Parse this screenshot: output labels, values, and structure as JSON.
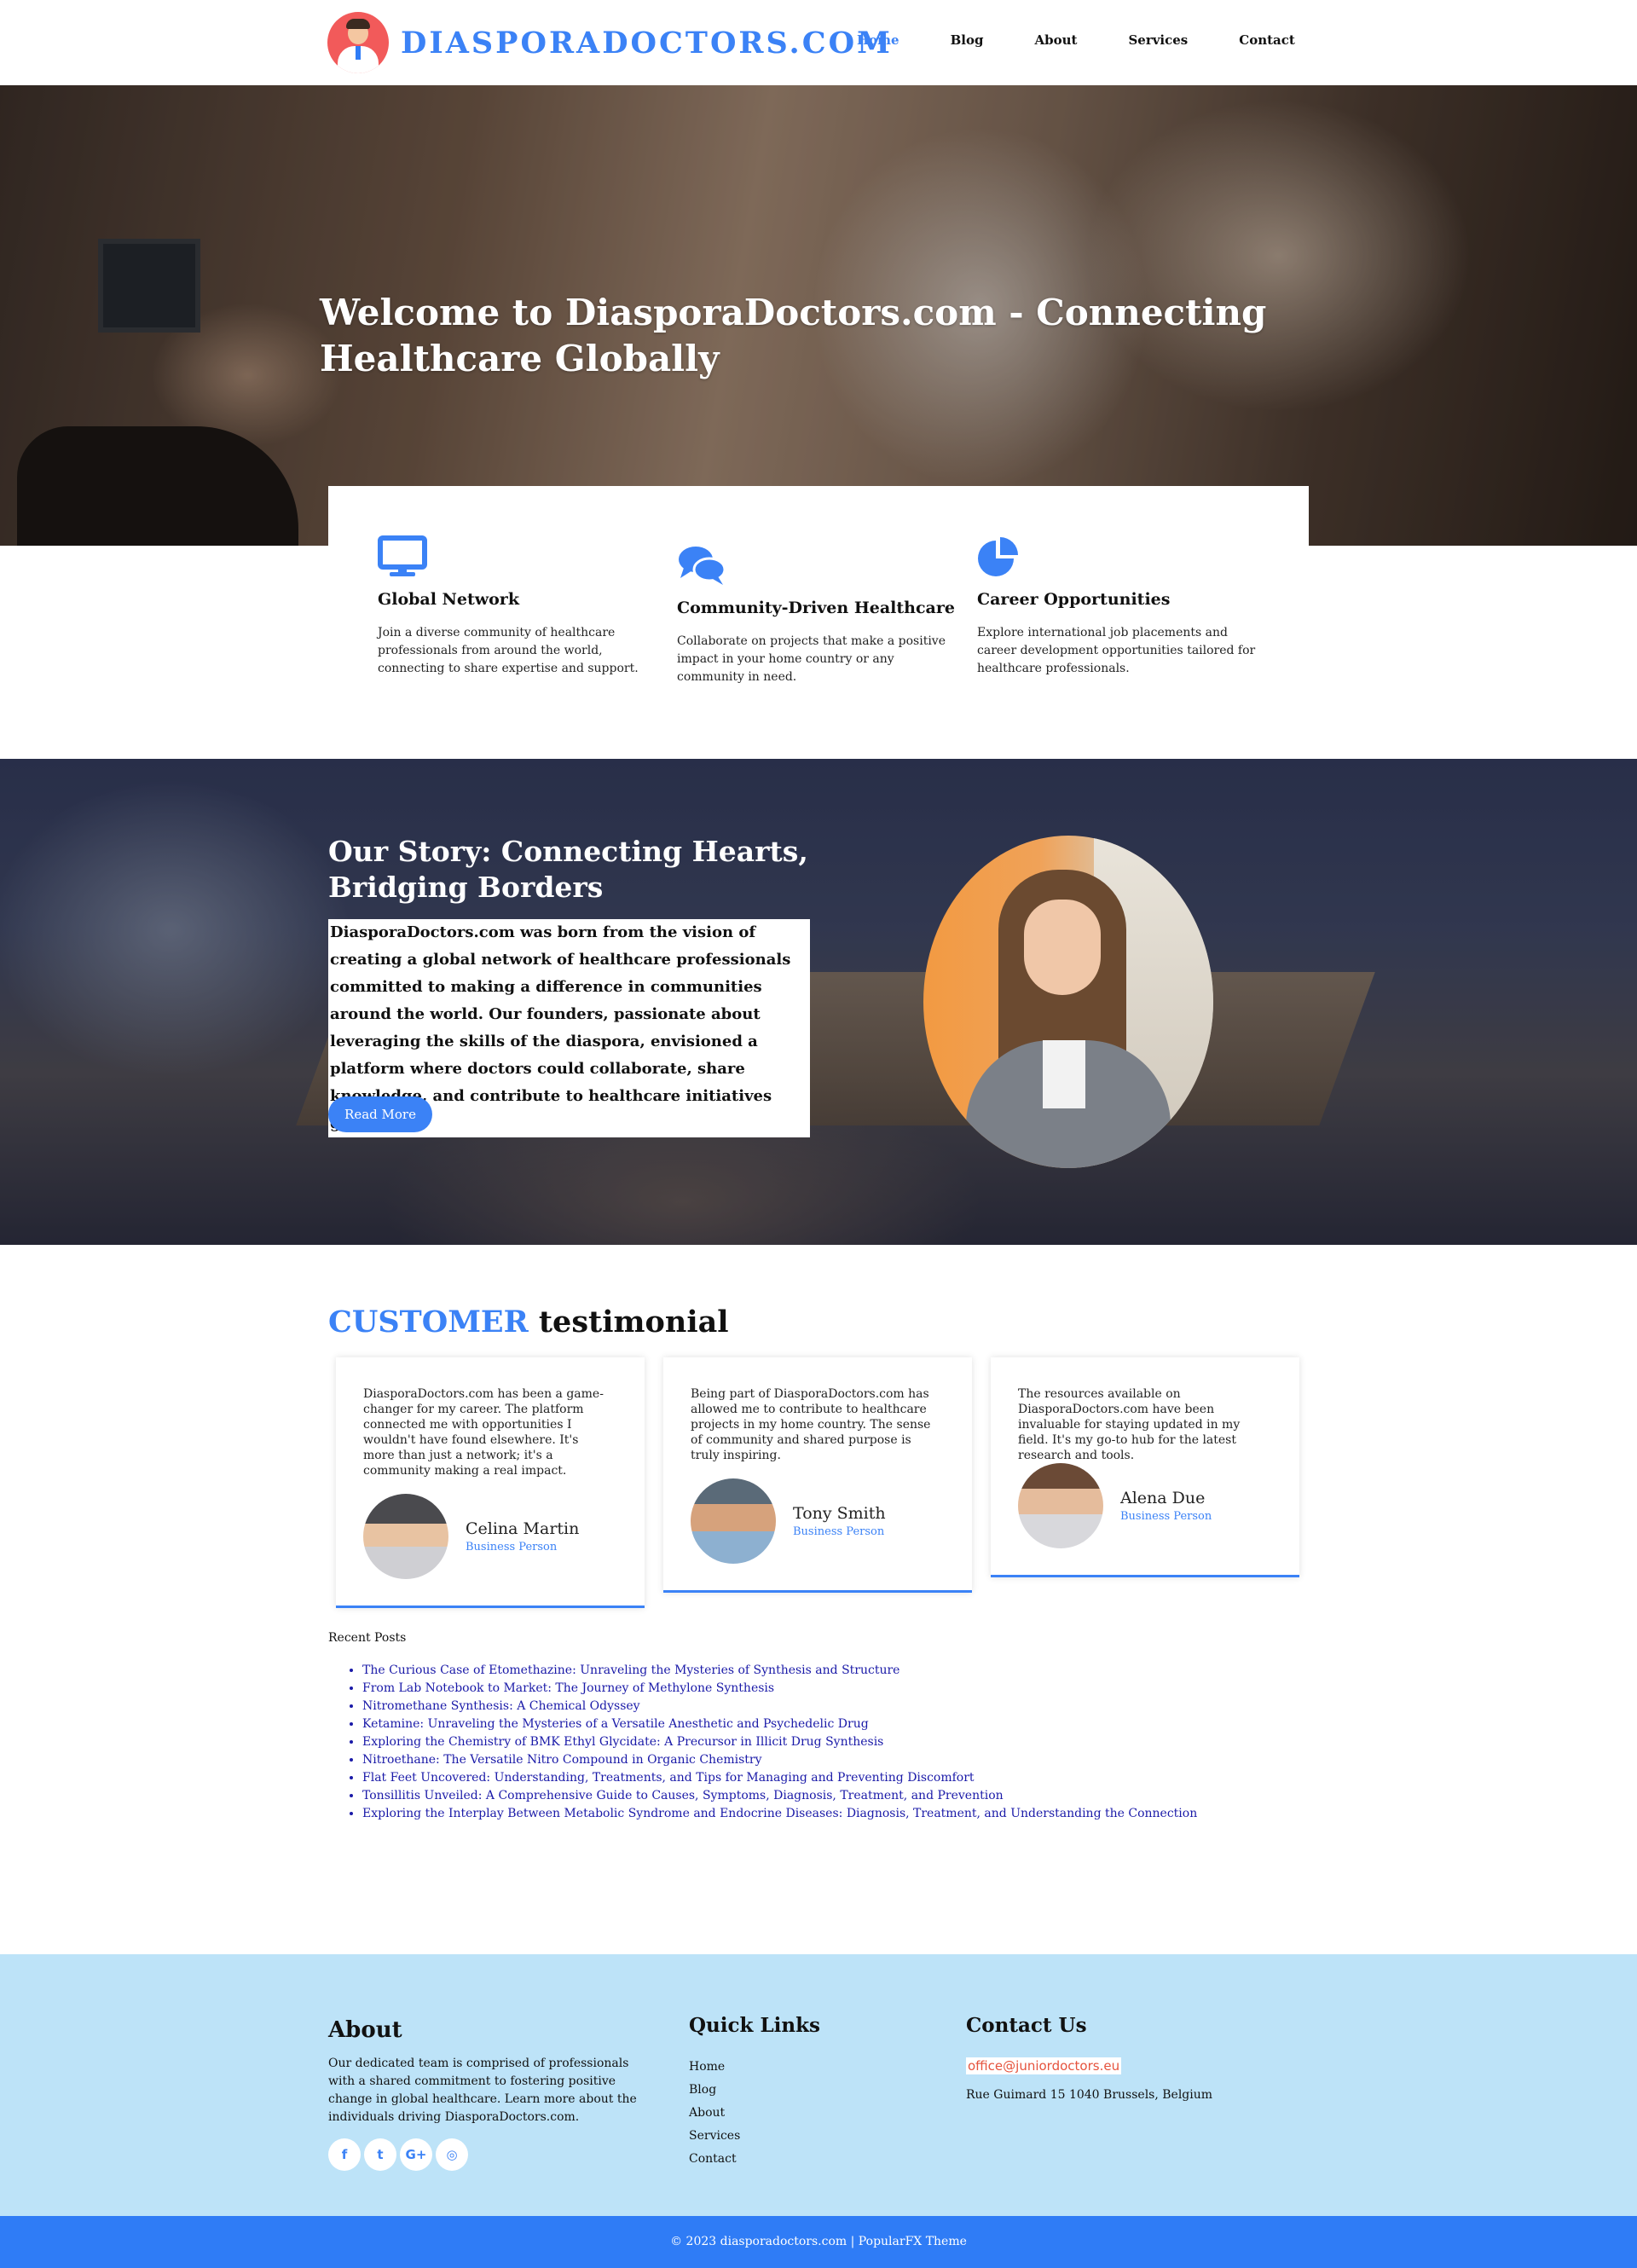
{
  "header": {
    "logo_text": "DIASPORADOCTORS.COM",
    "nav": [
      {
        "label": "Home",
        "active": true
      },
      {
        "label": "Blog",
        "active": false
      },
      {
        "label": "About",
        "active": false
      },
      {
        "label": "Services",
        "active": false
      },
      {
        "label": "Contact",
        "active": false
      }
    ]
  },
  "hero": {
    "title": "Welcome to DiasporaDoctors.com - Connecting Healthcare Globally"
  },
  "features": [
    {
      "icon": "monitor-icon",
      "title": "Global Network",
      "text": "Join a diverse community of healthcare professionals from around the world, connecting to share expertise and support."
    },
    {
      "icon": "comments-icon",
      "title": "Community-Driven Healthcare",
      "text": "Collaborate on projects that make a positive impact in your home country or any community in need."
    },
    {
      "icon": "pie-chart-icon",
      "title": "Career Opportunities",
      "text": "Explore international job placements and career development opportunities tailored for healthcare professionals."
    }
  ],
  "story": {
    "title": "Our Story: Connecting Hearts, Bridging Borders",
    "text": "DiasporaDoctors.com was born from the vision of creating a global network of healthcare professionals committed to making a difference in communities around the world. Our founders, passionate about leveraging the skills of the diaspora, envisioned a platform where doctors could collaborate, share knowledge, and contribute to healthcare initiatives globally.",
    "button": "Read More"
  },
  "testimonials": {
    "heading_accent": "CUSTOMER",
    "heading_rest": "testimonial",
    "items": [
      {
        "text": "DiasporaDoctors.com has been a game-changer for my career. The platform connected me with opportunities I wouldn't have found elsewhere. It's more than just a network; it's a community making a real impact.",
        "name": "Celina Martin",
        "role": "Business Person"
      },
      {
        "text": "Being part of DiasporaDoctors.com has allowed me to contribute to healthcare projects in my home country. The sense of community and shared purpose is truly inspiring.",
        "name": "Tony Smith",
        "role": "Business Person"
      },
      {
        "text": "The resources available on DiasporaDoctors.com have been invaluable for staying updated in my field. It's my go-to hub for the latest research and tools.",
        "name": "Alena Due",
        "role": "Business Person"
      }
    ]
  },
  "recent_posts": {
    "heading": "Recent Posts",
    "items": [
      "The Curious Case of Etomethazine: Unraveling the Mysteries of Synthesis and Structure",
      "From Lab Notebook to Market: The Journey of Methylone Synthesis",
      "Nitromethane Synthesis: A Chemical Odyssey",
      "Ketamine: Unraveling the Mysteries of a Versatile Anesthetic and Psychedelic Drug",
      "Exploring the Chemistry of BMK Ethyl Glycidate: A Precursor in Illicit Drug Synthesis",
      "Nitroethane: The Versatile Nitro Compound in Organic Chemistry",
      "Flat Feet Uncovered: Understanding, Treatments, and Tips for Managing and Preventing Discomfort",
      "Tonsillitis Unveiled: A Comprehensive Guide to Causes, Symptoms, Diagnosis, Treatment, and Prevention",
      "Exploring the Interplay Between Metabolic Syndrome and Endocrine Diseases: Diagnosis, Treatment, and Understanding the Connection"
    ]
  },
  "footer": {
    "about_title": "About",
    "about_text": "Our dedicated team is comprised of professionals with a shared commitment to fostering positive change in global healthcare. Learn more about the individuals driving DiasporaDoctors.com.",
    "social": [
      {
        "icon": "facebook-icon",
        "glyph": "f"
      },
      {
        "icon": "twitter-icon",
        "glyph": "t"
      },
      {
        "icon": "google-plus-icon",
        "glyph": "G+"
      },
      {
        "icon": "instagram-icon",
        "glyph": "◎"
      }
    ],
    "links_title": "Quick Links",
    "links": [
      "Home",
      "Blog",
      "About",
      "Services",
      "Contact"
    ],
    "contact_title": "Contact Us",
    "email": "office@juniordoctors.eu",
    "address": "Rue Guimard 15 1040 Brussels, Belgium"
  },
  "bottom_bar": "© 2023 diasporadoctors.com | PopularFX Theme",
  "colors": {
    "accent": "#3b82f6",
    "footer_bg": "#bde3f8",
    "bottom_bar": "#2f7cf6"
  }
}
